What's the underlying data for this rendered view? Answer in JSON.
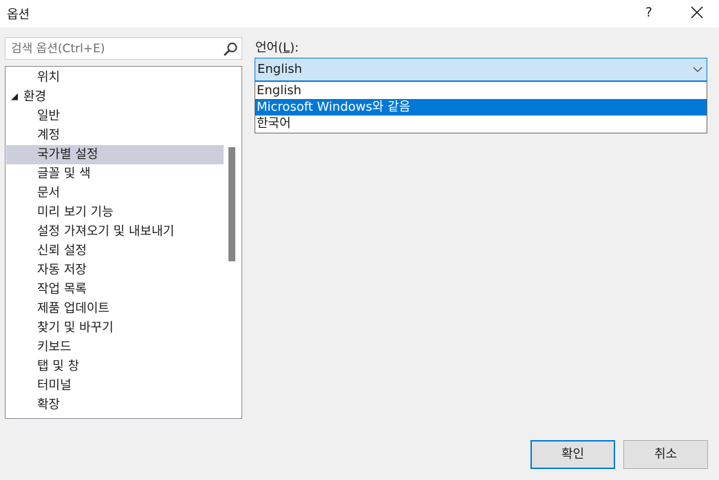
{
  "window": {
    "title": "옵션",
    "help_label": "?"
  },
  "search": {
    "placeholder": "검색 옵션(Ctrl+E)",
    "icon": "search-icon"
  },
  "tree": {
    "items": [
      {
        "label": "위치",
        "level": "child"
      },
      {
        "label": "환경",
        "level": "parent",
        "expanded": true,
        "expander": "◢"
      },
      {
        "label": "일반",
        "level": "child"
      },
      {
        "label": "계정",
        "level": "child"
      },
      {
        "label": "국가별 설정",
        "level": "child",
        "selected": true
      },
      {
        "label": "글꼴 및 색",
        "level": "child"
      },
      {
        "label": "문서",
        "level": "child"
      },
      {
        "label": "미리 보기 기능",
        "level": "child"
      },
      {
        "label": "설정 가져오기 및 내보내기",
        "level": "child"
      },
      {
        "label": "신뢰 설정",
        "level": "child"
      },
      {
        "label": "자동 저장",
        "level": "child"
      },
      {
        "label": "작업 목록",
        "level": "child"
      },
      {
        "label": "제품 업데이트",
        "level": "child"
      },
      {
        "label": "찾기 및 바꾸기",
        "level": "child"
      },
      {
        "label": "키보드",
        "level": "child"
      },
      {
        "label": "탭 및 창",
        "level": "child"
      },
      {
        "label": "터미널",
        "level": "child"
      },
      {
        "label": "확장",
        "level": "child"
      }
    ]
  },
  "language": {
    "label_prefix": "언어(",
    "label_access": "L",
    "label_suffix": "):",
    "selected": "English",
    "options": [
      {
        "label": "English",
        "highlighted": false
      },
      {
        "label": "Microsoft Windows와 같음",
        "highlighted": true
      },
      {
        "label": "한국어",
        "highlighted": false
      }
    ]
  },
  "buttons": {
    "ok": "확인",
    "cancel": "취소"
  },
  "colors": {
    "selected_tree_bg": "#cccedb",
    "accent": "#0078d7",
    "combo_bg": "#cce4f7"
  }
}
